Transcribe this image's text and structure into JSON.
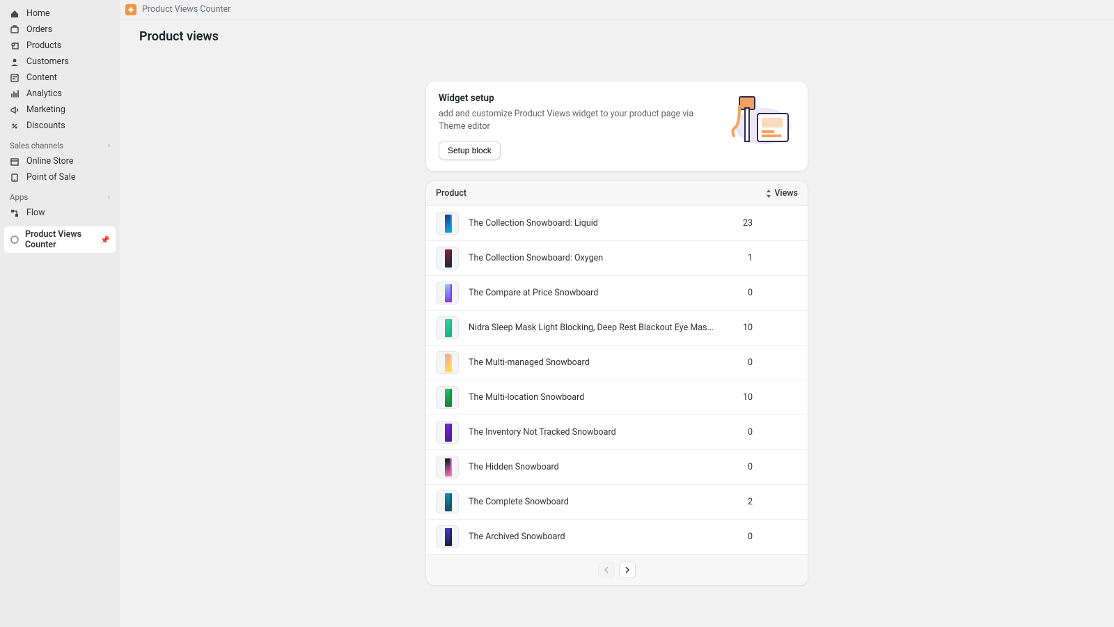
{
  "sidebar": {
    "main": [
      {
        "icon": "home",
        "label": "Home"
      },
      {
        "icon": "orders",
        "label": "Orders"
      },
      {
        "icon": "products",
        "label": "Products"
      },
      {
        "icon": "customers",
        "label": "Customers"
      },
      {
        "icon": "content",
        "label": "Content"
      },
      {
        "icon": "analytics",
        "label": "Analytics"
      },
      {
        "icon": "marketing",
        "label": "Marketing"
      },
      {
        "icon": "discounts",
        "label": "Discounts"
      }
    ],
    "sales_channels_label": "Sales channels",
    "sales_channels": [
      {
        "icon": "store",
        "label": "Online Store"
      },
      {
        "icon": "pos",
        "label": "Point of Sale"
      }
    ],
    "apps_label": "Apps",
    "apps": [
      {
        "icon": "flow",
        "label": "Flow"
      }
    ],
    "current_app": "Product Views Counter"
  },
  "topbar": {
    "app_name": "Product Views Counter"
  },
  "page": {
    "title": "Product views"
  },
  "setup": {
    "title": "Widget setup",
    "desc": "add and customize Product Views widget to your product page via Theme editor",
    "button": "Setup block"
  },
  "table": {
    "header_product": "Product",
    "header_views": "Views",
    "rows": [
      {
        "name": "The Collection Snowboard: Liquid",
        "views": 23,
        "c": "#1e3a8a,#0ea5e9"
      },
      {
        "name": "The Collection Snowboard: Oxygen",
        "views": 1,
        "c": "#8b1e3f,#1e293b"
      },
      {
        "name": "The Compare at Price Snowboard",
        "views": 0,
        "c": "#93c5fd,#7c3aed"
      },
      {
        "name": "Nidra Sleep Mask Light Blocking, Deep Rest Blackout Eye Mas...",
        "views": 10,
        "c": "#34d399,#10b981"
      },
      {
        "name": "The Multi-managed Snowboard",
        "views": 0,
        "c": "#fca5a5,#fde047"
      },
      {
        "name": "The Multi-location Snowboard",
        "views": 10,
        "c": "#22c55e,#15803d"
      },
      {
        "name": "The Inventory Not Tracked Snowboard",
        "views": 0,
        "c": "#6d28d9,#4c1d95"
      },
      {
        "name": "The Hidden Snowboard",
        "views": 0,
        "c": "#0f172a,#f472b6"
      },
      {
        "name": "The Complete Snowboard",
        "views": 2,
        "c": "#0891b2,#164e63"
      },
      {
        "name": "The Archived Snowboard",
        "views": 0,
        "c": "#4338ca,#1e1b4b"
      }
    ]
  }
}
